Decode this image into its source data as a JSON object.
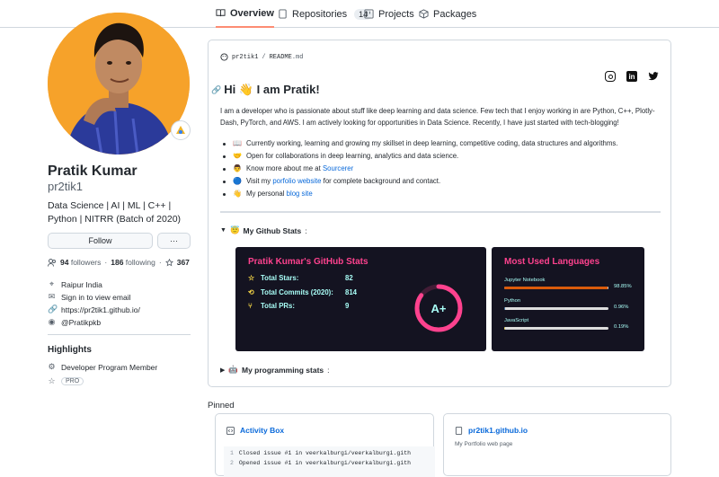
{
  "nav": {
    "tabs": [
      {
        "label": "Overview",
        "active": true,
        "icon": "book-icon"
      },
      {
        "label": "Repositories",
        "count": "14",
        "icon": "repo-icon"
      },
      {
        "label": "Projects",
        "icon": "project-icon"
      },
      {
        "label": "Packages",
        "icon": "package-icon"
      }
    ]
  },
  "profile": {
    "name": "Pratik Kumar",
    "login": "pr2tik1",
    "bio": "Data Science | AI | ML | C++ | Python | NITRR (Batch of 2020)",
    "follow_label": "Follow",
    "more_label": "···",
    "followers_count": "94",
    "followers_label": "followers",
    "following_count": "186",
    "following_label": "following",
    "stars_count": "367",
    "location": "Raipur India",
    "email": "Sign in to view email",
    "website": "https://pr2tik1.github.io/",
    "twitter": "@Pratikpkb",
    "highlights_title": "Highlights",
    "highlight_1": "Developer Program Member",
    "highlight_pro": "PRO"
  },
  "readme": {
    "path_user": "pr2tik1",
    "path_sep": "/",
    "path_file": "README",
    "path_ext": ".md",
    "heading": "Hi 👋 I am Pratik!",
    "intro": "I am a developer who is passionate about stuff like deep learning and data science. Few tech that I enjoy working in are Python, C++, Plotly-Dash, PyTorch, and AWS. I am actively looking for opportunities in Data Science. Recently, I have just started with tech-blogging!",
    "bullets": [
      {
        "emoji": "📖",
        "text": "Currently working, learning and growing my skillset in deep learning, competitive coding, data structures and algorithms."
      },
      {
        "emoji": "🤝",
        "pre": "Open for collaborations in deep learning, analytics and data science."
      },
      {
        "emoji": "👨",
        "pre": "Know more about me at ",
        "link": "Sourcerer"
      },
      {
        "emoji": "🔵",
        "pre": "Visit my ",
        "link": "porfolio website",
        "post": " for complete background and contact."
      },
      {
        "emoji": "👋",
        "pre": "My personal ",
        "link": "blog site"
      }
    ],
    "details_1": "My Github Stats",
    "details_1_emoji": "😇",
    "details_2": "My programming stats",
    "details_2_emoji": "🤖",
    "details_2_suffix": ":",
    "details_1_suffix": ":"
  },
  "stats_card": {
    "title": "Pratik Kumar's GitHub Stats",
    "rows": [
      {
        "label": "Total Stars:",
        "value": "82",
        "icon": "star-icon"
      },
      {
        "label": "Total Commits (2020):",
        "value": "814",
        "icon": "history-icon"
      },
      {
        "label": "Total PRs:",
        "value": "9",
        "icon": "pr-icon"
      }
    ],
    "grade": "A+",
    "grade_progress": 0.85,
    "colors": {
      "bg": "#141321",
      "title": "#fe428e",
      "text": "#a9fef7",
      "icon": "#f8d847"
    }
  },
  "langs_card": {
    "title": "Most Used Languages",
    "langs": [
      {
        "name": "Jupyter Notebook",
        "pct_label": "98.85%",
        "pct": 98.85,
        "color": "#DA5B0B"
      },
      {
        "name": "Python",
        "pct_label": "0.96%",
        "pct": 0.96,
        "color": "#3572A5"
      },
      {
        "name": "JavaScript",
        "pct_label": "0.19%",
        "pct": 0.19,
        "color": "#f1e05a"
      }
    ]
  },
  "pinned": {
    "title": "Pinned",
    "items": [
      {
        "name": "Activity Box",
        "lines": [
          {
            "n": "1",
            "text": "Closed issue #1 in veerkalburgi/veerkalburgi.gith"
          },
          {
            "n": "2",
            "text": "Opened issue #1 in veerkalburgi/veerkalburgi.gith"
          }
        ]
      },
      {
        "name": "pr2tik1.github.io",
        "desc": "My Portfolio web page"
      }
    ]
  }
}
